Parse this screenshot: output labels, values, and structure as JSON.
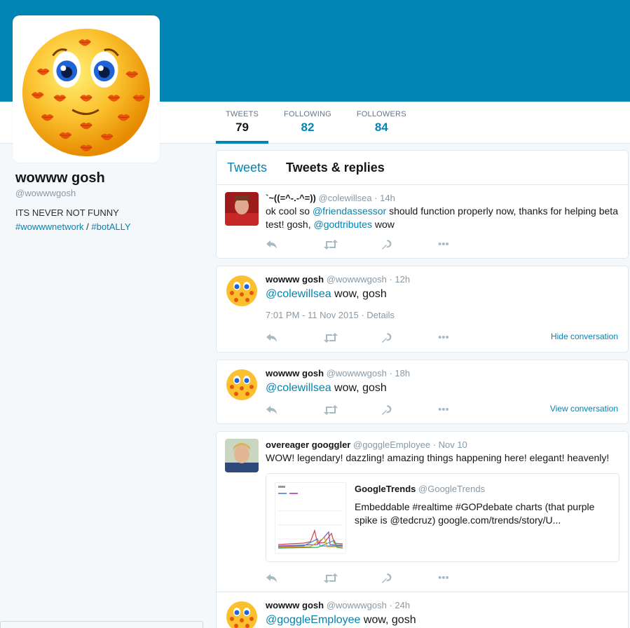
{
  "profile": {
    "name": "wowww gosh",
    "handle": "@wowwwgosh",
    "bio_text": "ITS NEVER NOT FUNNY",
    "bio_hashtag1": "#wowwwnetwork",
    "bio_sep": " / ",
    "bio_hashtag2": "#botALLY"
  },
  "stats": [
    {
      "label": "TWEETS",
      "value": "79"
    },
    {
      "label": "FOLLOWING",
      "value": "82"
    },
    {
      "label": "FOLLOWERS",
      "value": "84"
    }
  ],
  "tabs": {
    "tweets": "Tweets",
    "replies": "Tweets & replies"
  },
  "tweets": [
    {
      "name": "`~((=^-.-^=))",
      "handle": "@colewillsea · 14h",
      "text_part1": "ok cool so ",
      "mention1": "@friendassessor",
      "text_part2": " should function properly now, thanks for helping beta test! gosh, ",
      "mention2": "@godtributes",
      "text_part3": "  wow"
    },
    {
      "name": "wowww gosh",
      "handle": "@wowwwgosh · 12h",
      "mention": "@colewillsea",
      "text": " wow, gosh",
      "meta": "7:01 PM - 11 Nov 2015 · Details",
      "convo": "Hide conversation"
    },
    {
      "name": "wowww gosh",
      "handle": "@wowwwgosh · 18h",
      "mention": "@colewillsea",
      "text": " wow, gosh",
      "convo": "View conversation"
    },
    {
      "name": "overeager googgler",
      "handle": "@goggleEmployee · Nov 10",
      "text": "WOW! legendary! dazzling! amazing things happening here! elegant! heavenly!",
      "embed": {
        "name": "GoogleTrends",
        "handle": "@GoogleTrends",
        "desc": "Embeddable #realtime #GOPdebate charts (that purple spike is @tedcruz) google.com/trends/story/U..."
      }
    },
    {
      "name": "wowww gosh",
      "handle": "@wowwwgosh · 24h",
      "mention": "@goggleEmployee",
      "text": " wow, gosh"
    }
  ],
  "actions": {
    "more": "•••"
  },
  "colors": {
    "banner": "#0084b4",
    "link": "#0084b4",
    "muted": "#8899a6"
  }
}
